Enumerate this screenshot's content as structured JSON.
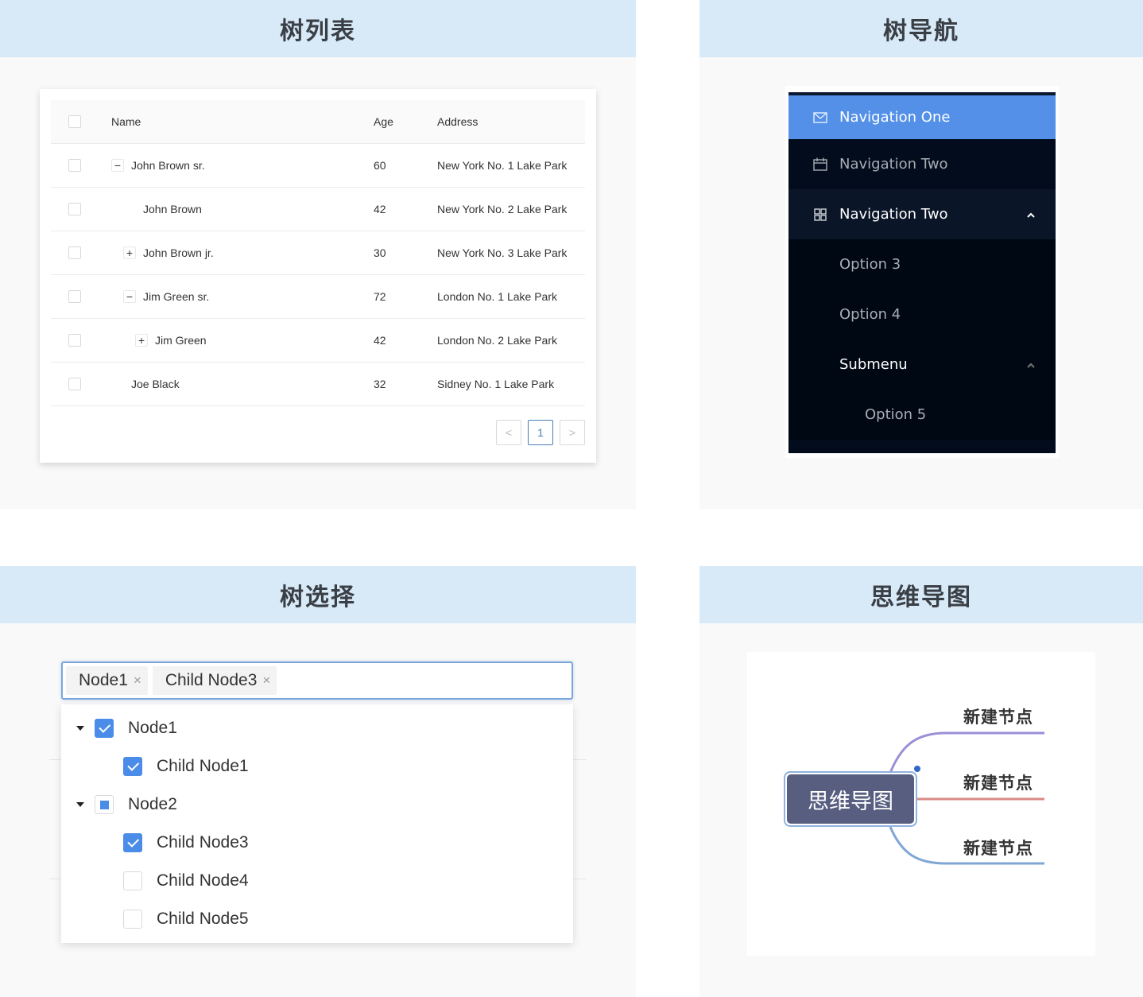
{
  "panels": {
    "tree_table": {
      "title": "树列表",
      "columns": [
        "Name",
        "Age",
        "Address"
      ],
      "rows": [
        {
          "name": "John Brown sr.",
          "age": "60",
          "address": "New York No. 1 Lake Park",
          "expander": "−",
          "level": 0
        },
        {
          "name": "John Brown",
          "age": "42",
          "address": "New York No. 2 Lake Park",
          "expander": "",
          "level": 1
        },
        {
          "name": "John Brown jr.",
          "age": "30",
          "address": "New York No. 3 Lake Park",
          "expander": "+",
          "level": 1
        },
        {
          "name": "Jim Green sr.",
          "age": "72",
          "address": "London No. 1 Lake Park",
          "expander": "−",
          "level": 1
        },
        {
          "name": "Jim Green",
          "age": "42",
          "address": "London No. 2 Lake Park",
          "expander": "+",
          "level": 2
        },
        {
          "name": "Joe Black",
          "age": "32",
          "address": "Sidney No. 1 Lake Park",
          "expander": "",
          "level": 0
        }
      ],
      "pagination": {
        "prev": "<",
        "current": "1",
        "next": ">"
      }
    },
    "tree_nav": {
      "title": "树导航",
      "items": [
        {
          "label": "Navigation One",
          "icon": "mail-icon",
          "state": "active"
        },
        {
          "label": "Navigation Two",
          "icon": "calendar-icon",
          "state": "normal"
        },
        {
          "label": "Navigation Two",
          "icon": "appstore-icon",
          "state": "open",
          "caret": "⌃"
        }
      ],
      "sub_items": [
        {
          "label": "Option 3"
        },
        {
          "label": "Option 4"
        }
      ],
      "submenu": {
        "label": "Submenu",
        "caret": "⌃",
        "items": [
          {
            "label": "Option 5"
          }
        ]
      },
      "colors": {
        "active": "#5490e8",
        "background": "#020c1c"
      }
    },
    "tree_select": {
      "title": "树选择",
      "tags": [
        {
          "label": "Node1",
          "close": "×"
        },
        {
          "label": "Child Node3",
          "close": "×"
        }
      ],
      "nodes": [
        {
          "label": "Node1",
          "level": 0,
          "state": "checked",
          "expanded": true
        },
        {
          "label": "Child Node1",
          "level": 1,
          "state": "checked"
        },
        {
          "label": "Node2",
          "level": 0,
          "state": "half",
          "expanded": true
        },
        {
          "label": "Child Node3",
          "level": 1,
          "state": "checked"
        },
        {
          "label": "Child Node4",
          "level": 1,
          "state": "unchecked"
        },
        {
          "label": "Child Node5",
          "level": 1,
          "state": "unchecked"
        }
      ],
      "colors": {
        "check": "#4b8ce8",
        "focus_border": "#7ba6da"
      }
    },
    "mindmap": {
      "title": "思维导图",
      "root": "思维导图",
      "children": [
        {
          "label": "新建节点",
          "color": "#9b8fd6"
        },
        {
          "label": "新建节点",
          "color": "#d98a86"
        },
        {
          "label": "新建节点",
          "color": "#7fa6d6"
        }
      ],
      "root_color": "#575e80"
    }
  }
}
